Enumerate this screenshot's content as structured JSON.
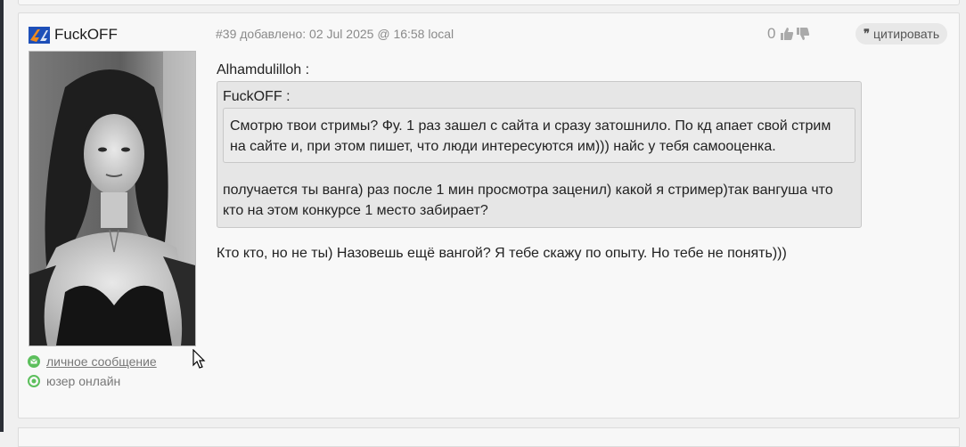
{
  "author": {
    "name": "FuckOFF",
    "pm_label": "личное сообщение",
    "status_label": "юзер онлайн"
  },
  "post": {
    "meta": "#39 добавлено: 02 Jul 2025 @ 16:58 local",
    "rating": "0",
    "quote_label": "цитировать"
  },
  "content": {
    "outer_quote_author": "Alhamdulilloh :",
    "inner_quote_author": "FuckOFF :",
    "inner_quote_text": "Смотрю твои стримы? Фу. 1 раз зашел с сайта и сразу затошнило. По кд апает свой стрим на сайте и, при этом пишет, что люди интересуются им))) найс у тебя самооценка.",
    "outer_quote_text": "получается ты ванга) раз после 1 мин просмотра заценил) какой я стример)так вангуша что кто на этом конкурсе 1 место забирает?",
    "reply_text": "Кто кто, но не ты) Назовешь ещё вангой? Я тебе скажу по опыту. Но тебе не понять)))"
  },
  "icons": {
    "flag": "flag-icon",
    "pm": "mail-icon",
    "online": "online-status-icon",
    "like": "thumb-up-icon",
    "dislike": "thumb-down-icon",
    "quote": "quote-icon",
    "cursor": "mouse-cursor-icon"
  },
  "colors": {
    "online_green": "#5cbf5c",
    "flag_blue": "#1e4fb8",
    "flag_orange": "#f08a1c"
  }
}
